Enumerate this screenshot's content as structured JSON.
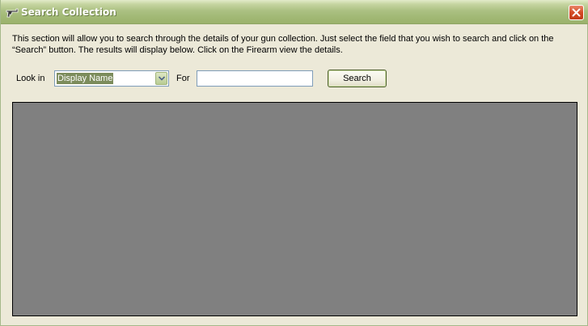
{
  "window": {
    "title": "Search Collection"
  },
  "description": {
    "line1": "This section will allow you to search through the details of your gun collection.  Just select the field that you wish to search and click on the",
    "line2": "“Search” button.  The results will display below.  Click on the Firearm view the details."
  },
  "search": {
    "look_in_label": "Look in",
    "look_in_value": "Display Name",
    "for_label": "For",
    "for_value": "",
    "for_placeholder": "",
    "button_label": "Search"
  },
  "icons": {
    "title": "gun-icon",
    "close": "close-icon",
    "dropdown": "chevron-down-icon"
  },
  "colors": {
    "titlebar": "#a2b976",
    "window_bg": "#ece9d8",
    "results_bg": "#808080",
    "close_button": "#d44a25",
    "selection": "#7c8c5c"
  }
}
